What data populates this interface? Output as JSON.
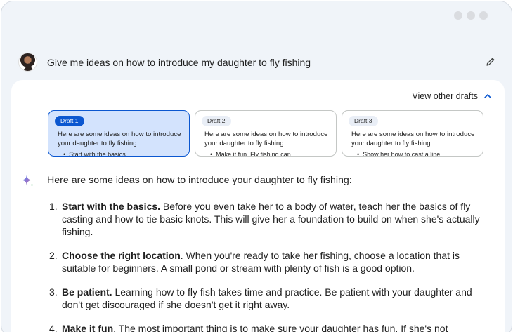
{
  "prompt": {
    "text": "Give me ideas on how to introduce my daughter to fly fishing"
  },
  "drafts_header": {
    "label": "View other drafts"
  },
  "drafts": [
    {
      "badge": "Draft 1",
      "text": "Here are some ideas on how to introduce your daughter to fly fishing:",
      "bullet": "Start with the basics",
      "selected": true
    },
    {
      "badge": "Draft 2",
      "text": "Here are some ideas on how to introduce your daughter to fly fishing:",
      "bullet": "Make it fun. Fly fishing can",
      "selected": false
    },
    {
      "badge": "Draft 3",
      "text": "Here are some ideas on how to introduce your daughter to fly fishing:",
      "bullet": "Show her how to cast a line",
      "selected": false
    }
  ],
  "response": {
    "intro": "Here are some ideas on how to introduce your daughter to fly fishing:",
    "items": [
      {
        "num": "1.",
        "title": "Start with the basics.",
        "body": " Before you even take her to a body of water, teach her the basics of fly casting and how to tie basic knots. This will give her a foundation to build on when she's actually fishing."
      },
      {
        "num": "2.",
        "title": "Choose the right location",
        "body": ". When you're ready to take her fishing, choose a location that is suitable for beginners. A small pond or stream with plenty of fish is a good option."
      },
      {
        "num": "3.",
        "title": "Be patient.",
        "body": " Learning how to fly fish takes time and practice. Be patient with your daughter and don't get discouraged if she doesn't get it right away."
      },
      {
        "num": "4.",
        "title": "Make it fun",
        "body": ". The most important thing is to make sure your daughter has fun. If she's not"
      }
    ]
  },
  "colors": {
    "accent": "#0b57d0",
    "selected_draft_bg": "#d3e3fd",
    "page_bg": "#f0f4f9"
  },
  "icons": {
    "edit": "pencil-icon",
    "collapse": "chevron-up-icon",
    "assistant": "sparkle-icon"
  }
}
